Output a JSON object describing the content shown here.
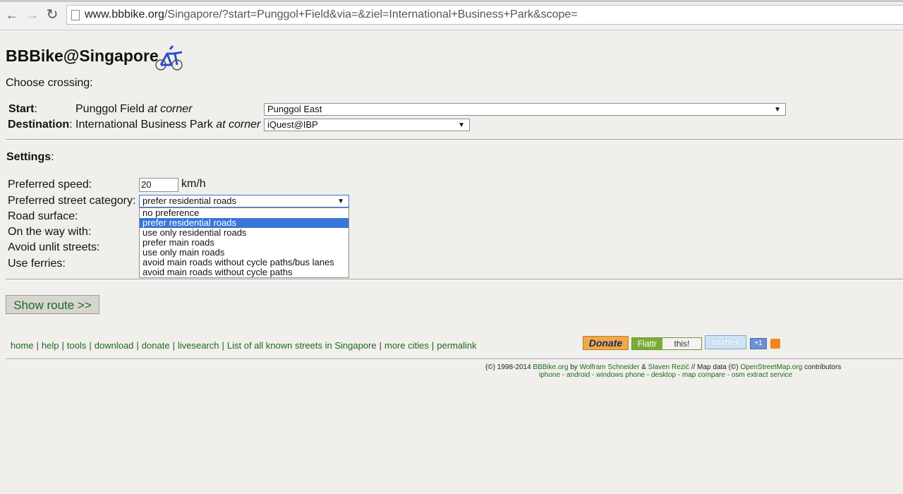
{
  "browser": {
    "url_host": "www.bbbike.org",
    "url_path": "/Singapore/?start=Punggol+Field&via=&ziel=International+Business+Park&scope="
  },
  "page": {
    "title": "BBBike@Singapore",
    "choose_crossing": "Choose crossing:"
  },
  "route": {
    "start_label": "Start",
    "start_colon": ":",
    "start_street": "Punggol Field",
    "at_corner": "at corner",
    "start_crossing": "Punggol East",
    "destination_label": "Destination",
    "destination_colon": ":",
    "destination_street": "International Business Park",
    "destination_crossing": "iQuest@IBP"
  },
  "settings": {
    "title": "Settings",
    "title_colon": ":",
    "preferred_speed_label": "Preferred speed:",
    "preferred_speed_value": "20",
    "speed_unit": "km/h",
    "street_category_label": "Preferred street category:",
    "street_category_selected": "prefer residential roads",
    "street_category_options": [
      "no preference",
      "prefer residential roads",
      "use only residential roads",
      "prefer main roads",
      "use only main roads",
      "avoid main roads without cycle paths/bus lanes",
      "avoid main roads without cycle paths"
    ],
    "road_surface_label": "Road surface:",
    "on_the_way_label": "On the way with:",
    "avoid_unlit_label": "Avoid unlit streets:",
    "use_ferries_label": "Use ferries:"
  },
  "actions": {
    "show_route": "Show route >>"
  },
  "footer": {
    "links": [
      "home",
      "help",
      "tools",
      "download",
      "donate",
      "livesearch",
      "List of all known streets in Singapore",
      "more cities",
      "permalink"
    ],
    "separator": "|",
    "donate_badge": "Donate",
    "flattr_left": "Flattr",
    "flattr_right": "this!",
    "twitter_badge": "twitter",
    "plusone": "+1",
    "copyright_prefix": "(©) 1998-2014",
    "copyright_site": "BBBike.org",
    "copyright_by": "by",
    "author1": "Wolfram Schneider",
    "copyright_and": "&",
    "author2": "Slaven Rezić",
    "copyright_mapdata": "// Map data (©)",
    "copyright_osm": "OpenStreetMap.org",
    "copyright_contributors": "contributors",
    "platform_links": "iphone - android - windows phone - desktop - map compare - osm extract service"
  },
  "colors": {
    "background": "#f1efec",
    "link_green": "#1b6b1b",
    "selection_blue": "#3875d7"
  }
}
